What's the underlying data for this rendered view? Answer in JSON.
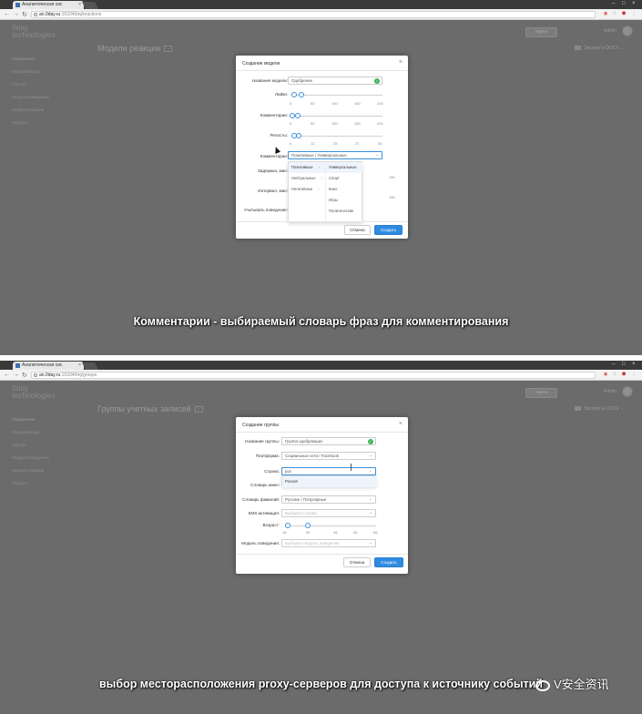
{
  "browser": {
    "tab_title": "Аналитическая сис",
    "tab_close": "×",
    "url_host": "an.0day.ru",
    "url_path_1": ":15334/bnj/reactions",
    "url_path_2": ":15334/bnj/groups"
  },
  "app": {
    "logo_line1": "0day",
    "logo_line2": "technologies",
    "sidebar": [
      {
        "label": "Управление"
      },
      {
        "label": "Инфолиоводы"
      },
      {
        "label": "Группы"
      },
      {
        "label": "Модели поведения"
      },
      {
        "label": "Модели реакции"
      },
      {
        "label": "Журнал"
      }
    ],
    "find_button": "Найти",
    "admin_label": "Admin",
    "export_label": "Экспорт в DOCX",
    "export_chevron": "⌄"
  },
  "frame1": {
    "page_title": "Модели реакции",
    "modal": {
      "title": "Создание модели",
      "close": "×",
      "name_label": "Название модели:",
      "name_value": "Одобрение",
      "likes_label": "Лайки:",
      "likes_ticks": [
        "0",
        "50",
        "100",
        "150",
        "200"
      ],
      "likes_value": [
        0,
        0
      ],
      "comments_label": "Комментарии:",
      "comments_ticks": [
        "0",
        "50",
        "100",
        "150",
        "200"
      ],
      "comments_value": [
        0,
        0
      ],
      "reposts_label": "Репосты:",
      "reposts_ticks": [
        "0",
        "12",
        "25",
        "37",
        "50"
      ],
      "reposts_value": [
        0,
        0
      ],
      "comments_dict_label": "Комментарии:",
      "comments_dict_value": "Позитивные / Универсальные",
      "delay_label": "Задержка, мин:",
      "interval_label": "Интервал, мин:",
      "behavior_label": "Учитывать поведение:",
      "hidden_tick_1": "150",
      "hidden_tick_2": "150",
      "dropdown_col1": [
        "Позитивные",
        "Нейтральные",
        "Негативные"
      ],
      "dropdown_col2": [
        "Универсальные",
        "Спорт",
        "Кино",
        "Игры",
        "Политические"
      ],
      "cancel_button": "Отмена",
      "create_button": "Создать"
    },
    "subtitle": "Комментарии - выбираемый словарь фраз для комментирования"
  },
  "frame2": {
    "page_title": "Группы учетных записей",
    "modal": {
      "title": "Создание группы",
      "close": "×",
      "name_label": "Название группы:",
      "name_value": "Группа одобряющих",
      "platform_label": "Платформа:",
      "platform_value": "Социальные сети / Facebook",
      "country_label": "Страна:",
      "country_value": "рос",
      "country_option": "Россия",
      "names_dict_label": "Словарь имен:",
      "surnames_dict_label": "Словарь фамилий:",
      "surnames_dict_value": "Русские / Популярные",
      "sms_label": "SMS-активация:",
      "sms_placeholder": "Выберите сервис",
      "age_label": "Возраст:",
      "age_ticks": [
        "18",
        "30",
        "45",
        "55",
        "65"
      ],
      "age_value": [
        18,
        30
      ],
      "behavior_label": "Модель поведения:",
      "behavior_placeholder": "Выберите модель поведения",
      "cancel_button": "Отмена",
      "create_button": "Создать"
    },
    "subtitle": "выбор месторасположения proxy-серверов для доступа к источнику событий"
  },
  "watermark": "V安全资讯",
  "colors": {
    "primary": "#2e8be0",
    "success": "#3fb35a",
    "overlay": "#6b6b6b"
  }
}
